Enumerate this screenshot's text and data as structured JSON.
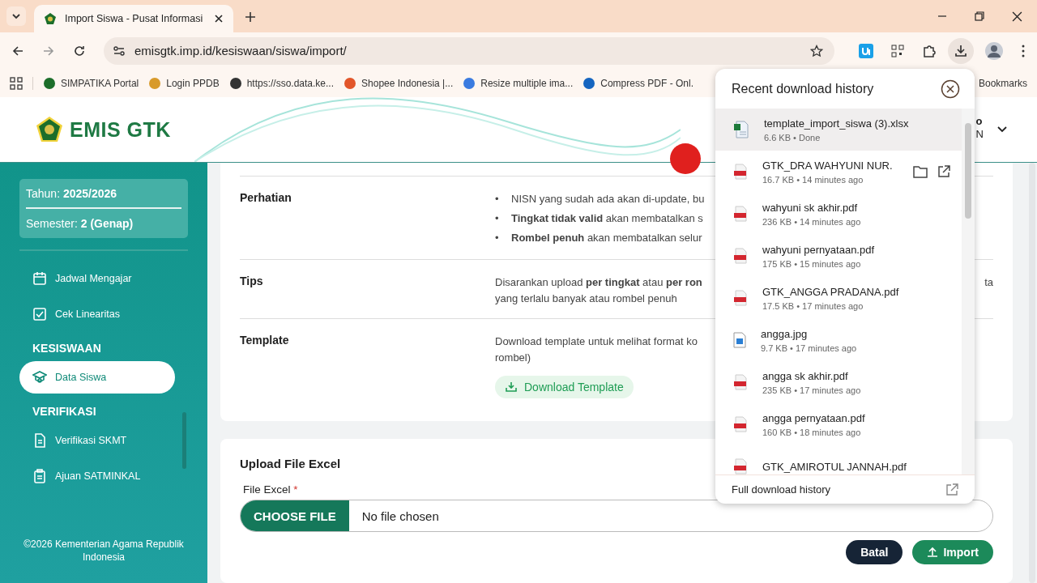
{
  "browser": {
    "tab_title": "Import Siswa - Pusat Informasi",
    "url": "emisgtk.imp.id/kesiswaan/siswa/import/",
    "bookmarks": [
      "SIMPATIKA Portal",
      "Login PPDB",
      "https://sso.data.ke...",
      "Shopee Indonesia |...",
      "Resize multiple ima...",
      "Compress PDF - Onl."
    ],
    "bookmarks_folder": "Bookmarks"
  },
  "header": {
    "logo_text": "EMIS GTK",
    "user_line_1": "o",
    "user_line_2": "N"
  },
  "sidebar": {
    "year_label": "Tahun:",
    "year": "2025/2026",
    "semester_label": "Semester:",
    "semester": "2 (Genap)",
    "items": [
      {
        "kind": "link",
        "label": "Jadwal Mengajar",
        "selected": false
      },
      {
        "kind": "link",
        "label": "Cek Linearitas",
        "selected": false
      },
      {
        "kind": "section",
        "label": "KESISWAAN"
      },
      {
        "kind": "link",
        "label": "Data Siswa",
        "selected": true
      },
      {
        "kind": "section",
        "label": "VERIFIKASI"
      },
      {
        "kind": "link",
        "label": "Verifikasi SKMT",
        "selected": false
      },
      {
        "kind": "link",
        "label": "Ajuan SATMINKAL",
        "selected": false
      }
    ],
    "footer": "©2026 Kementerian Agama Republik Indonesia"
  },
  "info": {
    "rows": [
      {
        "label": "Perhatian",
        "bullet": "•",
        "bullets": [
          "NISN yang sudah ada akan di-update, bu",
          "**Tingkat tidak valid** akan membatalkan s",
          "**Rombel penuh** akan membatalkan selur"
        ]
      },
      {
        "label": "Tips",
        "lines": [
          "Disarankan upload **per tingkat** atau **per ron**",
          "yang terlalu banyak atau rombel penuh"
        ],
        "line_end": "ta"
      },
      {
        "label": "Template",
        "lines": [
          "Download template untuk melihat format ko",
          "rombel)"
        ],
        "button": "Download Template"
      }
    ]
  },
  "upload": {
    "title": "Upload File Excel",
    "field_label": "File Excel",
    "required_mark": "*",
    "choose_button": "CHOOSE FILE",
    "file_status": "No file chosen",
    "cancel_button": "Batal",
    "import_button": "Import"
  },
  "downloads": {
    "title": "Recent download history",
    "items": [
      {
        "kind": "xlsx",
        "name": "template_import_siswa (3).xlsx",
        "meta": "6.6 KB • Done",
        "highlighted": true,
        "actions": false
      },
      {
        "kind": "pdf",
        "name": "GTK_DRA WAHYUNI NUR.",
        "meta": "16.7 KB • 14 minutes ago",
        "highlighted": false,
        "actions": true
      },
      {
        "kind": "pdf",
        "name": "wahyuni sk akhir.pdf",
        "meta": "236 KB • 14 minutes ago",
        "highlighted": false,
        "actions": false
      },
      {
        "kind": "pdf",
        "name": "wahyuni pernyataan.pdf",
        "meta": "175 KB • 15 minutes ago",
        "highlighted": false,
        "actions": false
      },
      {
        "kind": "pdf",
        "name": "GTK_ANGGA PRADANA.pdf",
        "meta": "17.5 KB • 17 minutes ago",
        "highlighted": false,
        "actions": false
      },
      {
        "kind": "image",
        "name": "angga.jpg",
        "meta": "9.7 KB • 17 minutes ago",
        "highlighted": false,
        "actions": false
      },
      {
        "kind": "pdf",
        "name": "angga sk akhir.pdf",
        "meta": "235 KB • 17 minutes ago",
        "highlighted": false,
        "actions": false
      },
      {
        "kind": "pdf",
        "name": "angga pernyataan.pdf",
        "meta": "160 KB • 18 minutes ago",
        "highlighted": false,
        "actions": false
      },
      {
        "kind": "pdf",
        "name": "GTK_AMIROTUL JANNAH.pdf",
        "highlighted": false,
        "actions": false
      }
    ],
    "footer": "Full download history"
  }
}
